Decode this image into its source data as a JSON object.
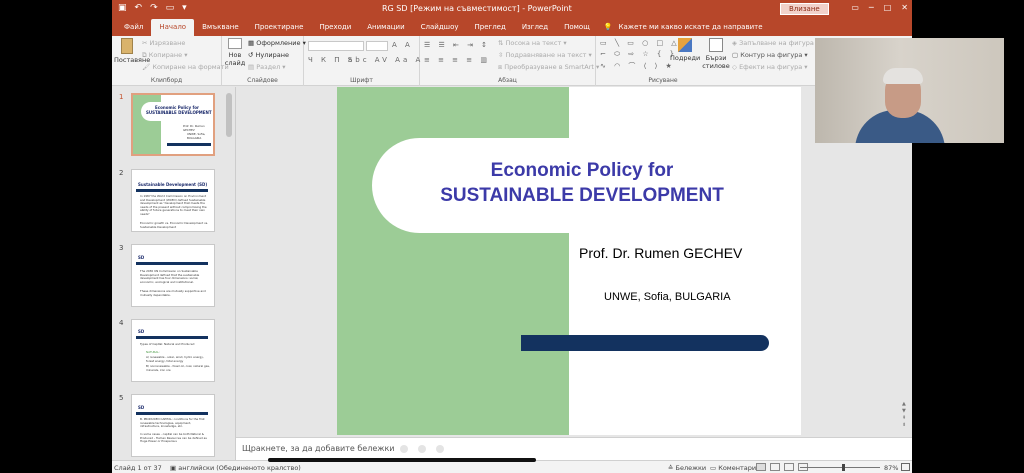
{
  "titlebar": {
    "title": "RG SD [Режим на съвместимост] - PowerPoint",
    "signin": "Влизане",
    "accent": "#b7472a"
  },
  "tabs": [
    "Файл",
    "Начало",
    "Вмъкване",
    "Проектиране",
    "Преходи",
    "Анимации",
    "Слайдшоу",
    "Преглед",
    "Изглед",
    "Помощ"
  ],
  "tell_me": "Кажете ми какво искате да направите",
  "ribbon": {
    "clipboard": {
      "paste": "Поставяне",
      "cut": "Изрязване",
      "copy": "Копиране",
      "format_painter": "Копиране на формати",
      "label": "Клипборд"
    },
    "slides": {
      "new_slide_1": "Нов",
      "new_slide_2": "слайд",
      "layout": "Оформление",
      "reset": "Нулиране",
      "section": "Раздел",
      "label": "Слайдове"
    },
    "font": {
      "label": "Шрифт",
      "style_buttons": "Ч К П S"
    },
    "paragraph": {
      "text_direction": "Посока на текст",
      "align_text": "Подравняване на текст",
      "smartart": "Преобразуване в SmartArt",
      "label": "Абзац"
    },
    "drawing": {
      "arrange": "Подреди",
      "quick_styles_1": "Бързи",
      "quick_styles_2": "стилове",
      "shape_fill": "Запълване на фигура",
      "shape_outline": "Контур на фигура",
      "shape_effects": "Ефекти на фигура",
      "label": "Рисуване"
    }
  },
  "thumbnails": [
    {
      "num": "1",
      "title_1": "Economic Policy for",
      "title_2": "SUSTAINABLE DEVELOPMENT",
      "author": "Prof. Dr. Rumen GECHEV",
      "inst": "UNWE, Sofia, BULGARIA"
    },
    {
      "num": "2",
      "title": "Sustainable Development (SD)",
      "body_1": "In 1987 the World Commission on Environment and Development (WCED) defined Sustainable development as \"development that meets the needs of the present without compromising the ability of future generations to meet their own needs\"",
      "body_2": "Economic growth vs. Economic Development vs. Sustainable Development"
    },
    {
      "num": "3",
      "title": "SD",
      "body_1": "The 2030 UN Commission on Sustainable Development defined that the sustainable development has four dimensions: social, economic, ecological and institutional.",
      "body_2": "These dimensions are mutually supportive and mutually dependable."
    },
    {
      "num": "4",
      "title": "SD",
      "body_1": "Types of Capital: Natural and Produced",
      "body_2": "NATURAL:",
      "body_3": "A) renewable - solar, wind, hydro energy, forest energy, tidal energy",
      "body_4": "B) nonrenewable - fossil oil, coal, natural gas, minerals, iron ore"
    },
    {
      "num": "5",
      "title": "SD",
      "body_1": "B. PRODUCED CAPITAL: conditions for the first renewable technologies, equipment, infrastructure, knowledge, etc.",
      "body_2": "In some cases - capital can be both Natural & Produced - Human Resources can be defined as Huge Power or Prosperous"
    }
  ],
  "slide": {
    "title_1": "Economic Policy for",
    "title_2": "SUSTAINABLE DEVELOPMENT",
    "author": "Prof. Dr. Rumen GECHEV",
    "institution": "UNWE, Sofia, BULGARIA",
    "green": "#9ccc96",
    "navy": "#13325f",
    "title_color": "#3c3aa8"
  },
  "notes_placeholder": "Щракнете, за да добавите бележки",
  "status": {
    "slide_of": "Слайд 1 от 37",
    "language": "английски (Обединеното кралство)",
    "notes": "Бележки",
    "comments": "Коментари",
    "zoom": "87%",
    "zoom_level": 0.52
  }
}
